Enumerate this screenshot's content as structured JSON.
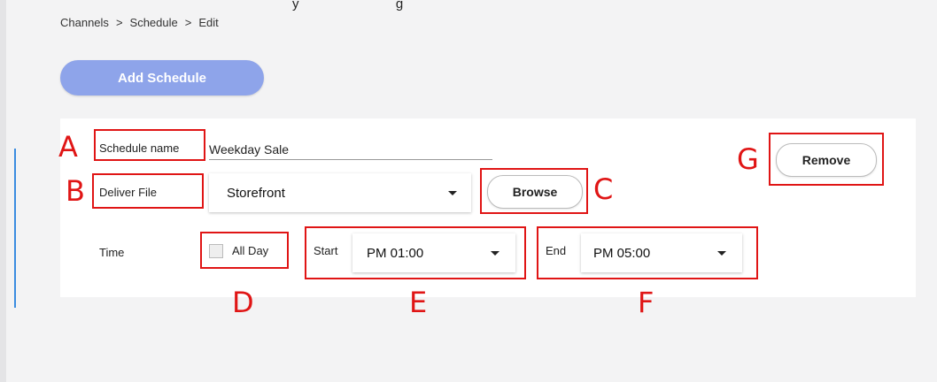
{
  "header_clip": "y                         g",
  "breadcrumb": [
    "Channels",
    ">",
    "Schedule",
    ">",
    "Edit"
  ],
  "add_schedule_label": "Add Schedule",
  "schedule": {
    "name_label": "Schedule name",
    "name_value": "Weekday Sale",
    "deliver_label": "Deliver File",
    "deliver_value": "Storefront",
    "browse_label": "Browse",
    "remove_label": "Remove",
    "time_label": "Time",
    "all_day_label": "All Day",
    "all_day_checked": false,
    "start_label": "Start",
    "start_value": "PM 01:00",
    "end_label": "End",
    "end_value": "PM 05:00"
  },
  "annotations": {
    "a": "A",
    "b": "B",
    "c": "C",
    "d": "D",
    "e": "E",
    "f": "F",
    "g": "G"
  },
  "colors": {
    "annotation": "#e01515",
    "accent": "#8ea4ea",
    "left_accent": "#3b8ce0"
  }
}
